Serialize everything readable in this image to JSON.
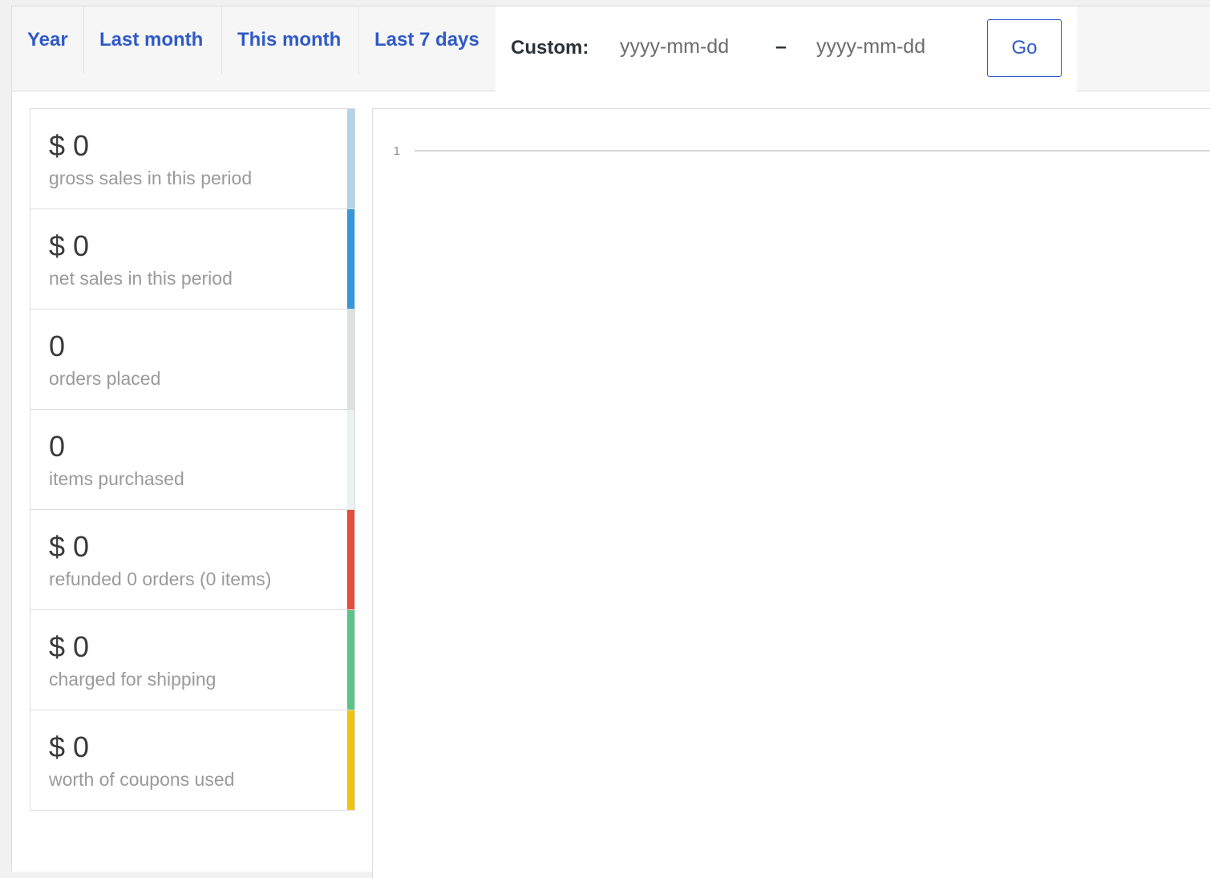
{
  "range_tabs": [
    {
      "label": "Year"
    },
    {
      "label": "Last month"
    },
    {
      "label": "This month"
    },
    {
      "label": "Last 7 days"
    }
  ],
  "custom_range": {
    "label": "Custom:",
    "from_placeholder": "yyyy-mm-dd",
    "separator": "–",
    "to_placeholder": "yyyy-mm-dd",
    "go_label": "Go"
  },
  "stats": [
    {
      "value": "$ 0",
      "label": "gross sales in this period",
      "color": "#b1d4ea"
    },
    {
      "value": "$ 0",
      "label": "net sales in this period",
      "color": "#3498db"
    },
    {
      "value": "0",
      "label": "orders placed",
      "color": "#dbe1e3"
    },
    {
      "value": "0",
      "label": "items purchased",
      "color": "#ecf0f1"
    },
    {
      "value": "$ 0",
      "label": "refunded 0 orders (0 items)",
      "color": "#e74c3c"
    },
    {
      "value": "$ 0",
      "label": "charged for shipping",
      "color": "#5cc488"
    },
    {
      "value": "$ 0",
      "label": "worth of coupons used",
      "color": "#f1c40f"
    }
  ],
  "chart_data": {
    "type": "line",
    "series": [],
    "y_ticks": [
      "1"
    ],
    "ylim": [
      0,
      1
    ],
    "grid": true
  }
}
